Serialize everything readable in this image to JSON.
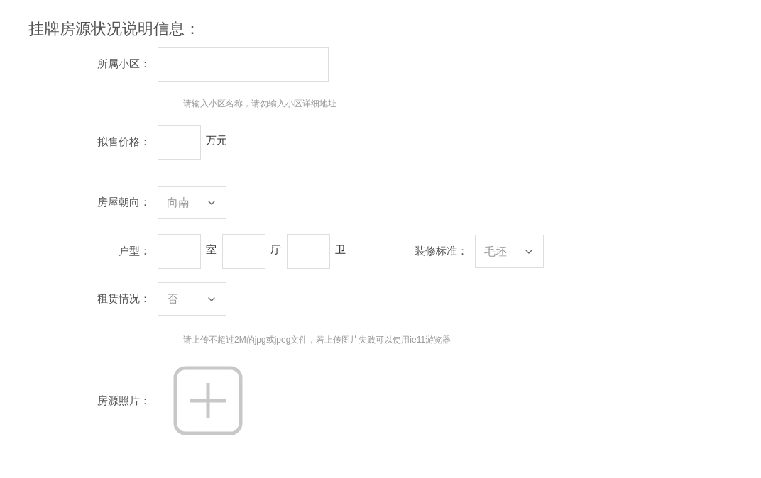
{
  "title": "挂牌房源状况说明信息：",
  "community": {
    "label": "所属小区：",
    "hint": "请输入小区名称，请勿输入小区详细地址"
  },
  "price": {
    "label": "拟售价格：",
    "unit": "万元"
  },
  "orientation": {
    "label": "房屋朝向：",
    "value": "向南"
  },
  "layout": {
    "label": "户型：",
    "units": [
      "室",
      "厅",
      "卫"
    ]
  },
  "decoration": {
    "label": "装修标准：",
    "value": "毛坯"
  },
  "lease": {
    "label": "租赁情况：",
    "value": "否"
  },
  "upload_hint": "请上传不超过2M的jpg或jpeg文件，若上传图片失败可以使用ie11游览器",
  "photo": {
    "label": "房源照片："
  }
}
